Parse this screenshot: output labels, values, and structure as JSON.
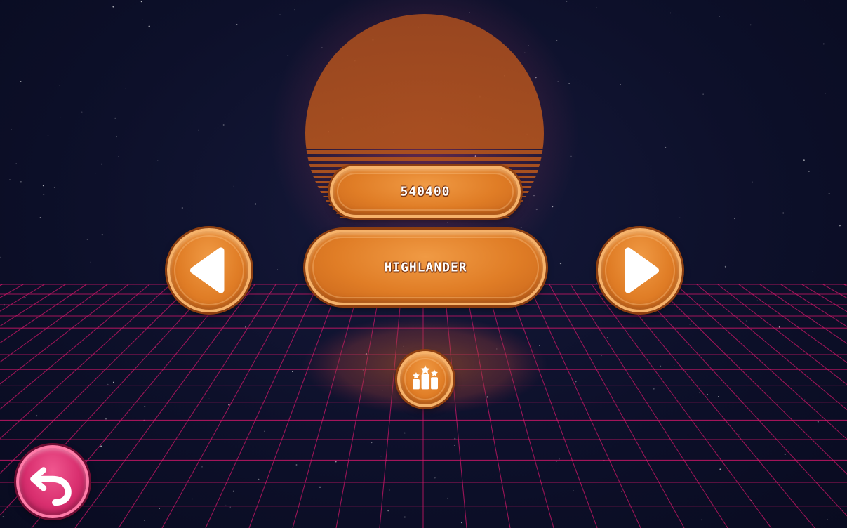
{
  "score": {
    "value": "540400"
  },
  "track": {
    "name": "HIGHLANDER"
  },
  "icons": {
    "prev": "play-left-icon",
    "next": "play-right-icon",
    "leaderboard": "podium-stars-icon",
    "back": "undo-arrow-icon"
  },
  "colors": {
    "background": "#0c1029",
    "grid": "#d6176b",
    "sun": "#b5561e",
    "button_orange": "#e07d26",
    "button_border": "#f6b26a",
    "back_button_pink": "#d92f6f"
  }
}
